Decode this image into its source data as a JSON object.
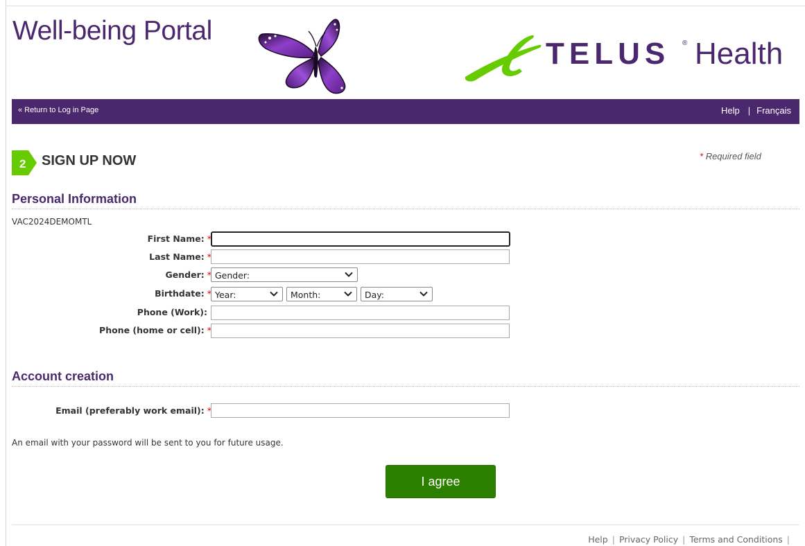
{
  "header": {
    "portal_title": "Well-being Portal",
    "brand_word": "TELUS",
    "brand_reg": "®",
    "brand_suffix": "Health"
  },
  "nav": {
    "return_link": "« Return to Log in Page",
    "help": "Help",
    "separator": "|",
    "language": "Français"
  },
  "step": {
    "number": "2",
    "title": "SIGN UP NOW",
    "required_star": "*",
    "required_note": "Required field"
  },
  "personal": {
    "title": "Personal Information",
    "code": "VAC2024DEMOMTL",
    "first_name_label": "First Name:",
    "first_name_value": "",
    "last_name_label": "Last Name:",
    "last_name_value": "",
    "gender_label": "Gender:",
    "gender_selected": "Gender:",
    "birthdate_label": "Birthdate:",
    "year_selected": "Year:",
    "month_selected": "Month:",
    "day_selected": "Day:",
    "phone_work_label": "Phone (Work):",
    "phone_work_value": "",
    "phone_home_label": "Phone (home or cell):",
    "phone_home_value": "",
    "star": "*"
  },
  "account": {
    "title": "Account creation",
    "email_label": "Email (preferably work email):",
    "email_value": "",
    "note": "An email with your password will be sent to you for future usage."
  },
  "actions": {
    "agree_label": "I agree"
  },
  "footer": {
    "help": "Help",
    "privacy": "Privacy Policy",
    "terms": "Terms and Conditions",
    "separator": "|"
  },
  "colors": {
    "brand_purple": "#4b286d",
    "accent_green": "#66cc00",
    "button_green": "#2b8000",
    "required_red": "#d90000"
  },
  "icons": {
    "butterfly": "butterfly-logo",
    "telus_mark": "telus-swoosh-icon",
    "dropdown": "chevron-down-icon",
    "step_badge": "step-arrow-badge"
  }
}
